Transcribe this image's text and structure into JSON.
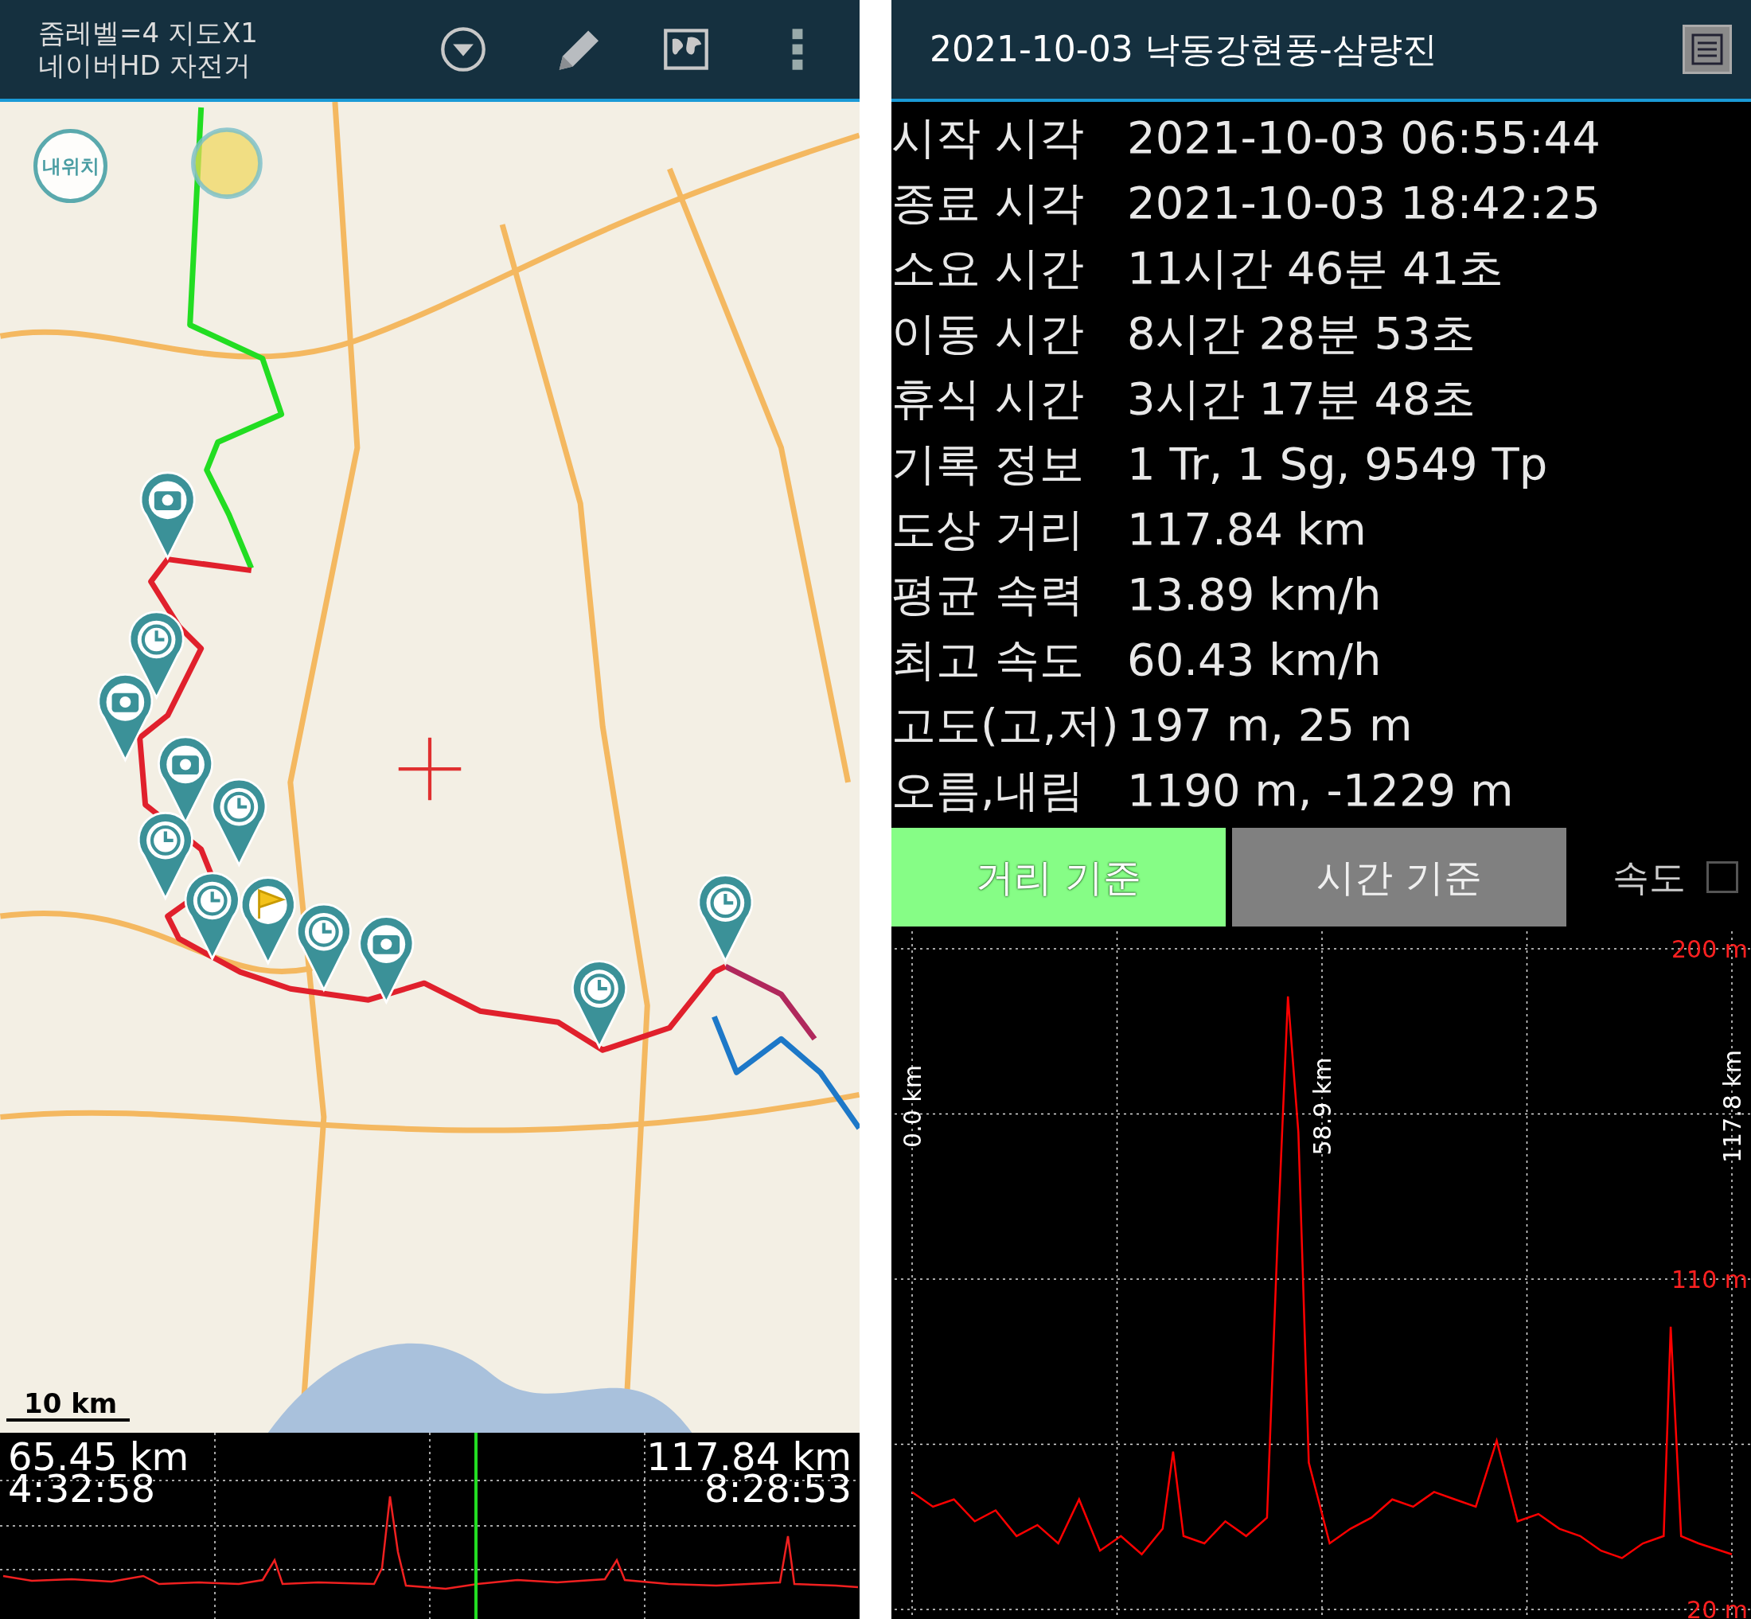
{
  "left_panel": {
    "toolbar": {
      "title_lines": [
        "줌레벨=4 지도X1",
        "네이버HD 자전거"
      ]
    },
    "map": {
      "my_location_button": "내위치",
      "scale_label": "10 km"
    },
    "profile_strip": {
      "distance_left": "65.45 km",
      "time_left": "4:32:58",
      "distance_right": "117.84 km",
      "time_right": "8:28:53"
    }
  },
  "right_panel": {
    "title": "2021-10-03 낙동강현풍-삼량진",
    "stats": [
      {
        "label": "시작 시각",
        "value": "2021-10-03 06:55:44"
      },
      {
        "label": "종료 시각",
        "value": "2021-10-03 18:42:25"
      },
      {
        "label": "소요 시간",
        "value": "11시간 46분 41초"
      },
      {
        "label": "이동 시간",
        "value": "8시간 28분 53초"
      },
      {
        "label": "휴식 시간",
        "value": "3시간 17분 48초"
      },
      {
        "label": "기록 정보",
        "value": "1 Tr, 1 Sg, 9549 Tp"
      },
      {
        "label": "도상 거리",
        "value": "117.84 km"
      },
      {
        "label": "평균 속력",
        "value": "13.89 km/h"
      },
      {
        "label": "최고 속도",
        "value": "60.43 km/h"
      },
      {
        "label": "고도(고,저)",
        "value": "197 m, 25 m"
      },
      {
        "label": "오름,내림",
        "value": "1190 m, -1229 m"
      }
    ],
    "mode_buttons": [
      {
        "label": "거리 기준",
        "selected": true
      },
      {
        "label": "시간 기준",
        "selected": false
      }
    ],
    "speed_toggle": {
      "label": "속도",
      "checked": false
    },
    "chart_data": {
      "type": "line",
      "xlim": [
        0,
        117.8
      ],
      "ylim": [
        20,
        200
      ],
      "xticks": [
        {
          "value": 0,
          "label": "0.0 km"
        },
        {
          "value": 58.9,
          "label": "58.9 km"
        },
        {
          "value": 117.8,
          "label": "117.8 km"
        }
      ],
      "yticks": [
        {
          "value": 20,
          "label": "20 m"
        },
        {
          "value": 110,
          "label": "110 m"
        },
        {
          "value": 200,
          "label": "200 m"
        }
      ],
      "x": [
        0,
        3,
        6,
        9,
        12,
        15,
        18,
        21,
        24,
        27,
        30,
        33,
        36,
        37.5,
        39,
        42,
        45,
        48,
        51,
        52.5,
        54,
        55.5,
        57,
        60,
        63,
        66,
        69,
        72,
        75,
        78,
        81,
        84,
        87,
        90,
        93,
        96,
        99,
        102,
        105,
        108,
        109,
        110.5,
        113,
        117.8
      ],
      "series": [
        {
          "color": "#ff0000",
          "values": [
            52,
            48,
            50,
            44,
            47,
            40,
            43,
            38,
            50,
            36,
            40,
            35,
            42,
            63,
            40,
            38,
            44,
            40,
            45,
            120,
            187,
            150,
            60,
            38,
            42,
            45,
            50,
            48,
            52,
            50,
            48,
            66,
            44,
            46,
            42,
            40,
            36,
            34,
            38,
            40,
            97,
            40,
            38,
            35
          ]
        }
      ]
    }
  }
}
